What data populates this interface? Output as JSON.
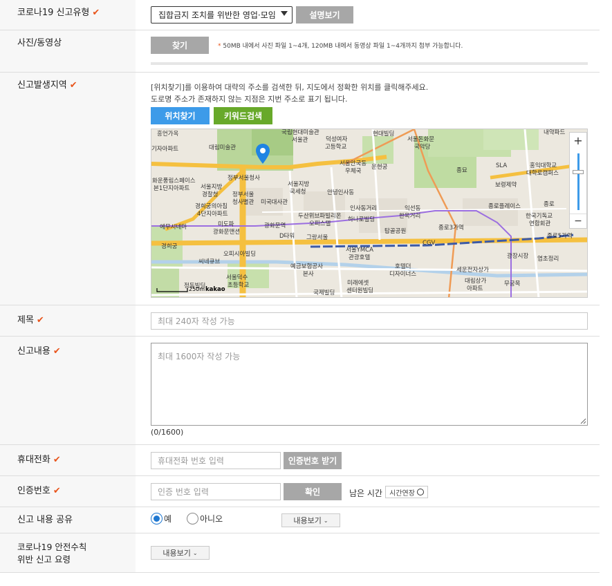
{
  "report_type": {
    "label": "코로나19 신고유형",
    "selected": "집합금지 조치를 위반한 영업·모임",
    "explain_button": "설명보기"
  },
  "media": {
    "label": "사진/동영상",
    "find_button": "찾기",
    "note_star": "*",
    "note": "50MB 내에서 사진 파일 1~4개, 120MB 내에서 동영상 파일 1~4개까지 첨부 가능합니다."
  },
  "location": {
    "label": "신고발생지역",
    "help1": "[위치찾기]를 이용하여 대략의 주소를 검색한 뒤, 지도에서 정확한 위치를 클릭해주세요.",
    "help2": "도로명 주소가 존재하지 않는 지점은 지번 주소로 표기 됩니다.",
    "find_location_button": "위치찾기",
    "keyword_search_button": "키워드검색",
    "colors": {
      "blue_button": "#3d9be9",
      "green_button": "#68a92a",
      "marker": "#1f84e3"
    },
    "map": {
      "zoom_in": "+",
      "zoom_out": "−",
      "scale_label": "250m",
      "provider": "kakao",
      "labels": [
        "흥언가옥",
        "국립현대미술관",
        "서울관",
        "덕성여자",
        "고등학교",
        "현대빌딩",
        "서울돈화문",
        "국악당",
        "내약파드",
        "대림미술관",
        "서울안국동",
        "우체국",
        "운현궁",
        "종묘",
        "SLA",
        "홍익대학교",
        "대학로캠퍼스",
        "기자아파트",
        "화운풍림스페이스",
        "본1단지아파트",
        "정부서울청사",
        "서울지방",
        "경찰청",
        "정부서울",
        "청사별관",
        "서울지방",
        "국세청",
        "안녕인사동",
        "인사동거리",
        "익선동",
        "한옥거리",
        "보령제약",
        "종로플레이스",
        "종로",
        "경희궁의아침",
        "4단지아파트",
        "미국대사관",
        "두산위브파빌리온",
        "오피스텔",
        "하나로빌딩",
        "탑골공원",
        "종로3가역",
        "한국기독교",
        "연합회관",
        "에무시네마",
        "미도파",
        "광화문맨션",
        "광화문역",
        "D타워",
        "그랑서울",
        "서울YMCA",
        "관광호텔",
        "CGV",
        "종로5가역",
        "경희궁",
        "오피시아빌딩",
        "씨네큐브",
        "예금보험공사",
        "본사",
        "호텔더",
        "디자이너스",
        "세운전자상가",
        "광장시장",
        "염초정리",
        "서울덕수",
        "초등학교",
        "정동빌딩",
        "미래에셋",
        "센터원빌딩",
        "국제빌딩",
        "대림상가",
        "아파트",
        "무궁목",
        "국세청",
        "광화문역"
      ]
    }
  },
  "title_field": {
    "label": "제목",
    "placeholder": "최대 240자 작성 가능"
  },
  "content_field": {
    "label": "신고내용",
    "placeholder": "최대 1600자 작성 가능",
    "counter": "(0/1600)"
  },
  "phone": {
    "label": "휴대전화",
    "placeholder": "휴대전화 번호 입력",
    "request_button": "인증번호 받기"
  },
  "auth": {
    "label": "인증번호",
    "placeholder": "인증 번호 입력",
    "confirm_button": "확인",
    "remaining_label": "남은 시간 :",
    "extend_button": "시간연장"
  },
  "share": {
    "label": "신고 내용 공유",
    "yes": "예",
    "no": "아니오",
    "yes_selected": true,
    "view_button": "내용보기"
  },
  "guide": {
    "label_line1": "코로나19 안전수칙",
    "label_line2": "위반 신고 요령",
    "view_button": "내용보기"
  },
  "accent_color": "#e8541b"
}
